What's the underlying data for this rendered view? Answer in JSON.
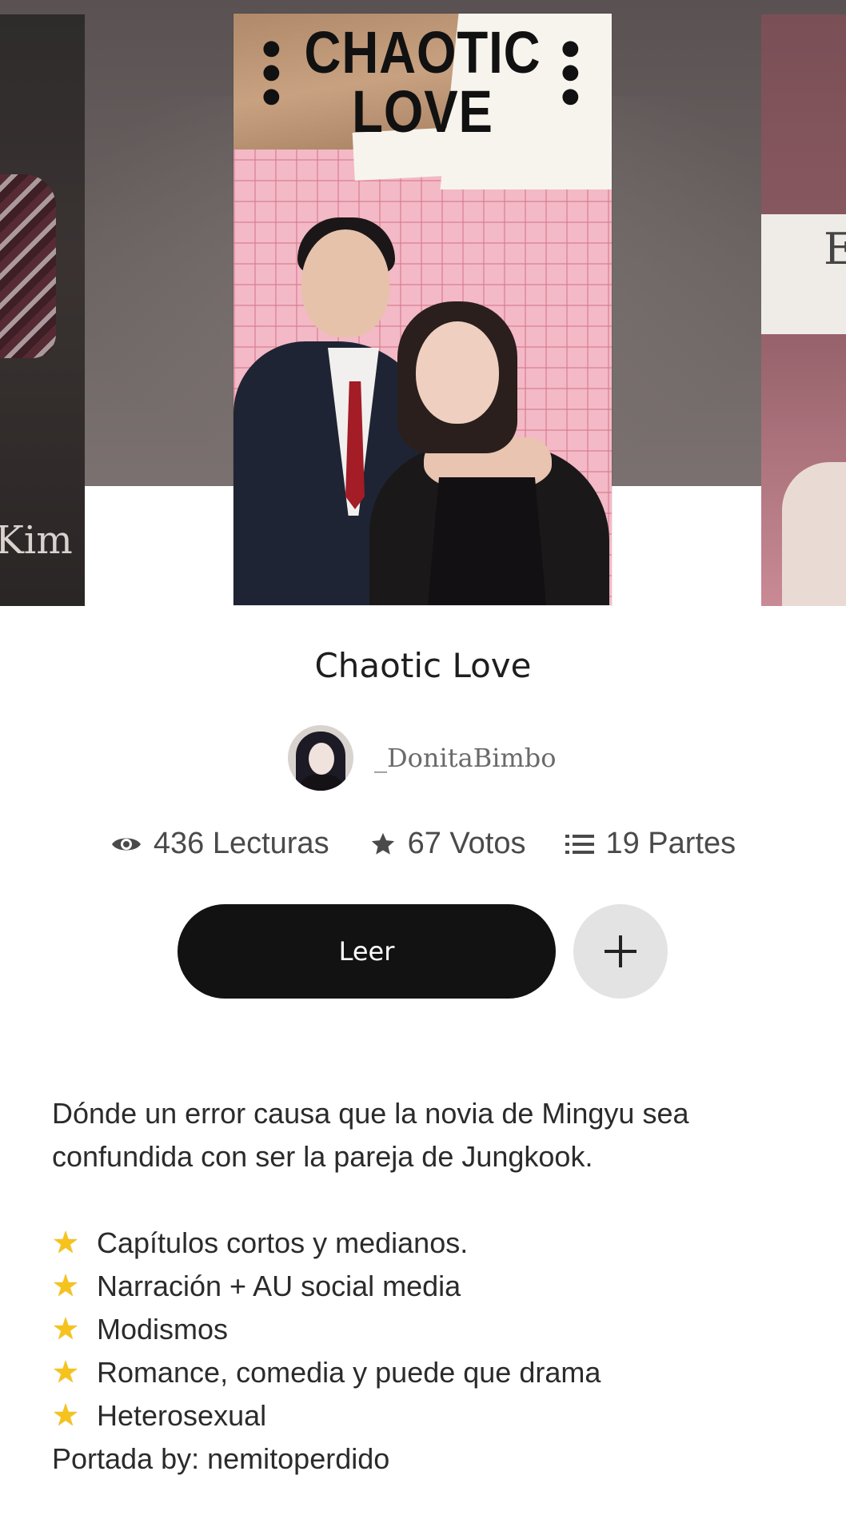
{
  "carousel": {
    "left_cover_text": "Kim",
    "right_cover_text": "E",
    "main_cover": {
      "title_line1": "CHAOTIC",
      "title_line2": "LOVE"
    }
  },
  "story": {
    "title": "Chaotic Love",
    "author": "_DonitaBimbo"
  },
  "stats": {
    "reads": "436 Lecturas",
    "votes": "67 Votos",
    "parts": "19 Partes"
  },
  "actions": {
    "read_label": "Leer",
    "add_label": "+"
  },
  "description": {
    "line1": "Dónde un error causa que la novia de Mingyu sea",
    "line2": "confundida con ser la pareja de Jungkook.",
    "bullets": [
      "Capítulos cortos y medianos.",
      "Narración + AU social media",
      "Modismos",
      "Romance, comedia y puede que drama",
      "Heterosexual"
    ],
    "bullet_icon": "star-emoji",
    "credit": "Portada by: nemitoperdido"
  },
  "colors": {
    "read_button": "#121212",
    "add_button": "#e3e3e3",
    "star": "#f5c31c"
  }
}
